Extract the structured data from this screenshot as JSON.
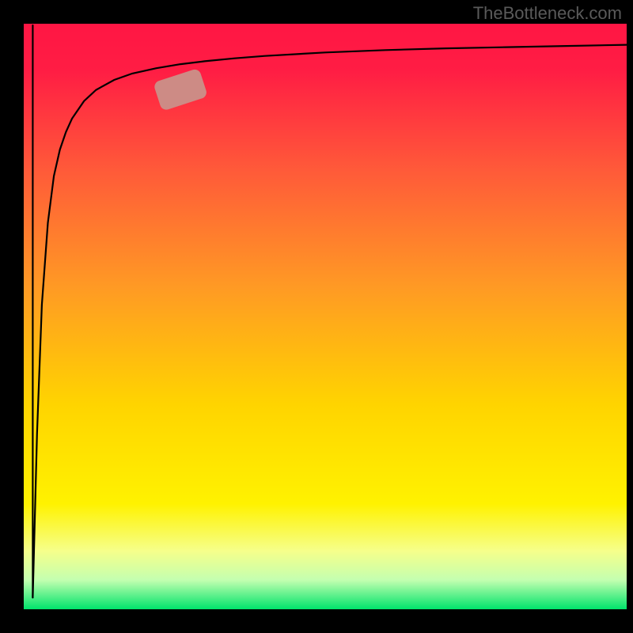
{
  "watermark": "TheBottleneck.com",
  "chart_data": {
    "type": "line",
    "title": "",
    "xlabel": "",
    "ylabel": "",
    "xlim": [
      0,
      100
    ],
    "ylim": [
      0,
      100
    ],
    "series": [
      {
        "name": "bottleneck-curve",
        "x": [
          1.5,
          2.2,
          3,
          4,
          5,
          6,
          7,
          8,
          10,
          12,
          15,
          18,
          22,
          26,
          30,
          35,
          40,
          50,
          60,
          70,
          80,
          90,
          100
        ],
        "y": [
          2,
          30,
          52,
          66,
          74,
          78.5,
          81.5,
          83.8,
          86.8,
          88.7,
          90.4,
          91.5,
          92.4,
          93.1,
          93.6,
          94.1,
          94.5,
          95.1,
          95.5,
          95.8,
          96.0,
          96.2,
          96.4
        ]
      }
    ],
    "annotations": [
      {
        "name": "marker",
        "x_range": [
          22,
          30
        ],
        "y_range": [
          87.0,
          90.5
        ],
        "color": "#cd8b85"
      }
    ],
    "background": {
      "type": "vertical-gradient",
      "top_color": "#ff1644",
      "mid_color": "#ffe100",
      "bottom_color": "#00e36b"
    },
    "axes": {
      "left_margin": 30,
      "right_margin": 8,
      "top_margin": 30,
      "bottom_margin": 30,
      "frame_thickness_lr": 30,
      "frame_thickness_tb": 30
    }
  }
}
